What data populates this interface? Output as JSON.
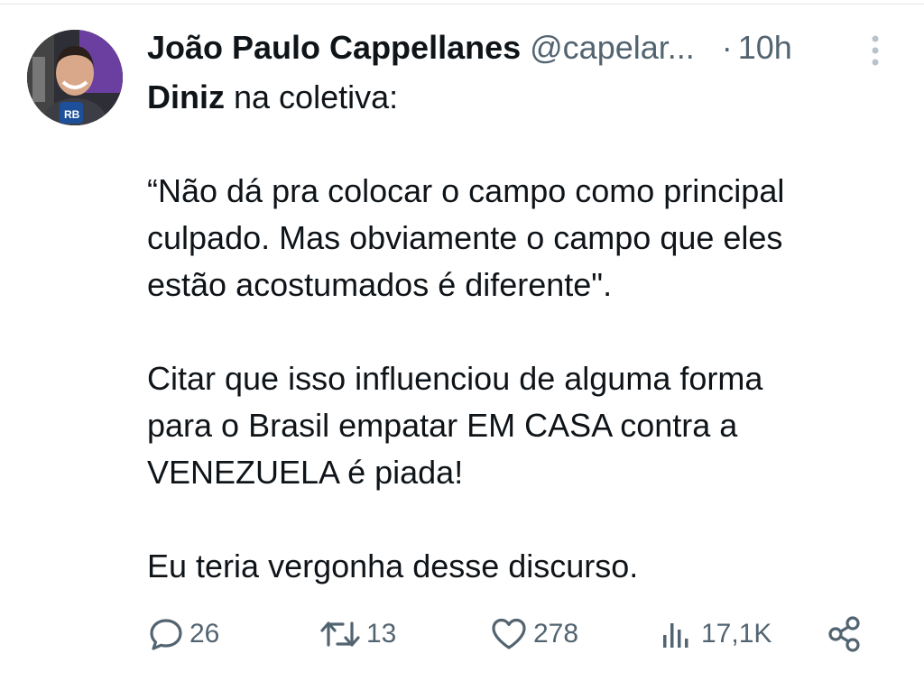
{
  "tweet": {
    "display_name": "João Paulo Cappellanes",
    "handle": "@capelar...",
    "separator": "·",
    "time": "10h",
    "avatar_icon": "user-avatar-photo",
    "more_icon": "more-vertical-icon",
    "mention_bold": "Diniz",
    "line1_rest": " na coletiva:",
    "quote_lines": [
      "“Não dá pra colocar o campo como principal",
      "culpado. Mas obviamente o campo que eles",
      "estão acostumados é diferente\"."
    ],
    "comment_lines": [
      "Citar que isso influenciou de alguma forma",
      "para o Brasil empatar EM CASA contra a",
      "VENEZUELA é piada!"
    ],
    "closing": "Eu teria vergonha desse discurso."
  },
  "actions": {
    "replies": "26",
    "retweets": "13",
    "likes": "278",
    "views": "17,1K"
  },
  "colors": {
    "text": "#0f1419",
    "muted": "#536471",
    "divider": "#e6e6e6"
  }
}
